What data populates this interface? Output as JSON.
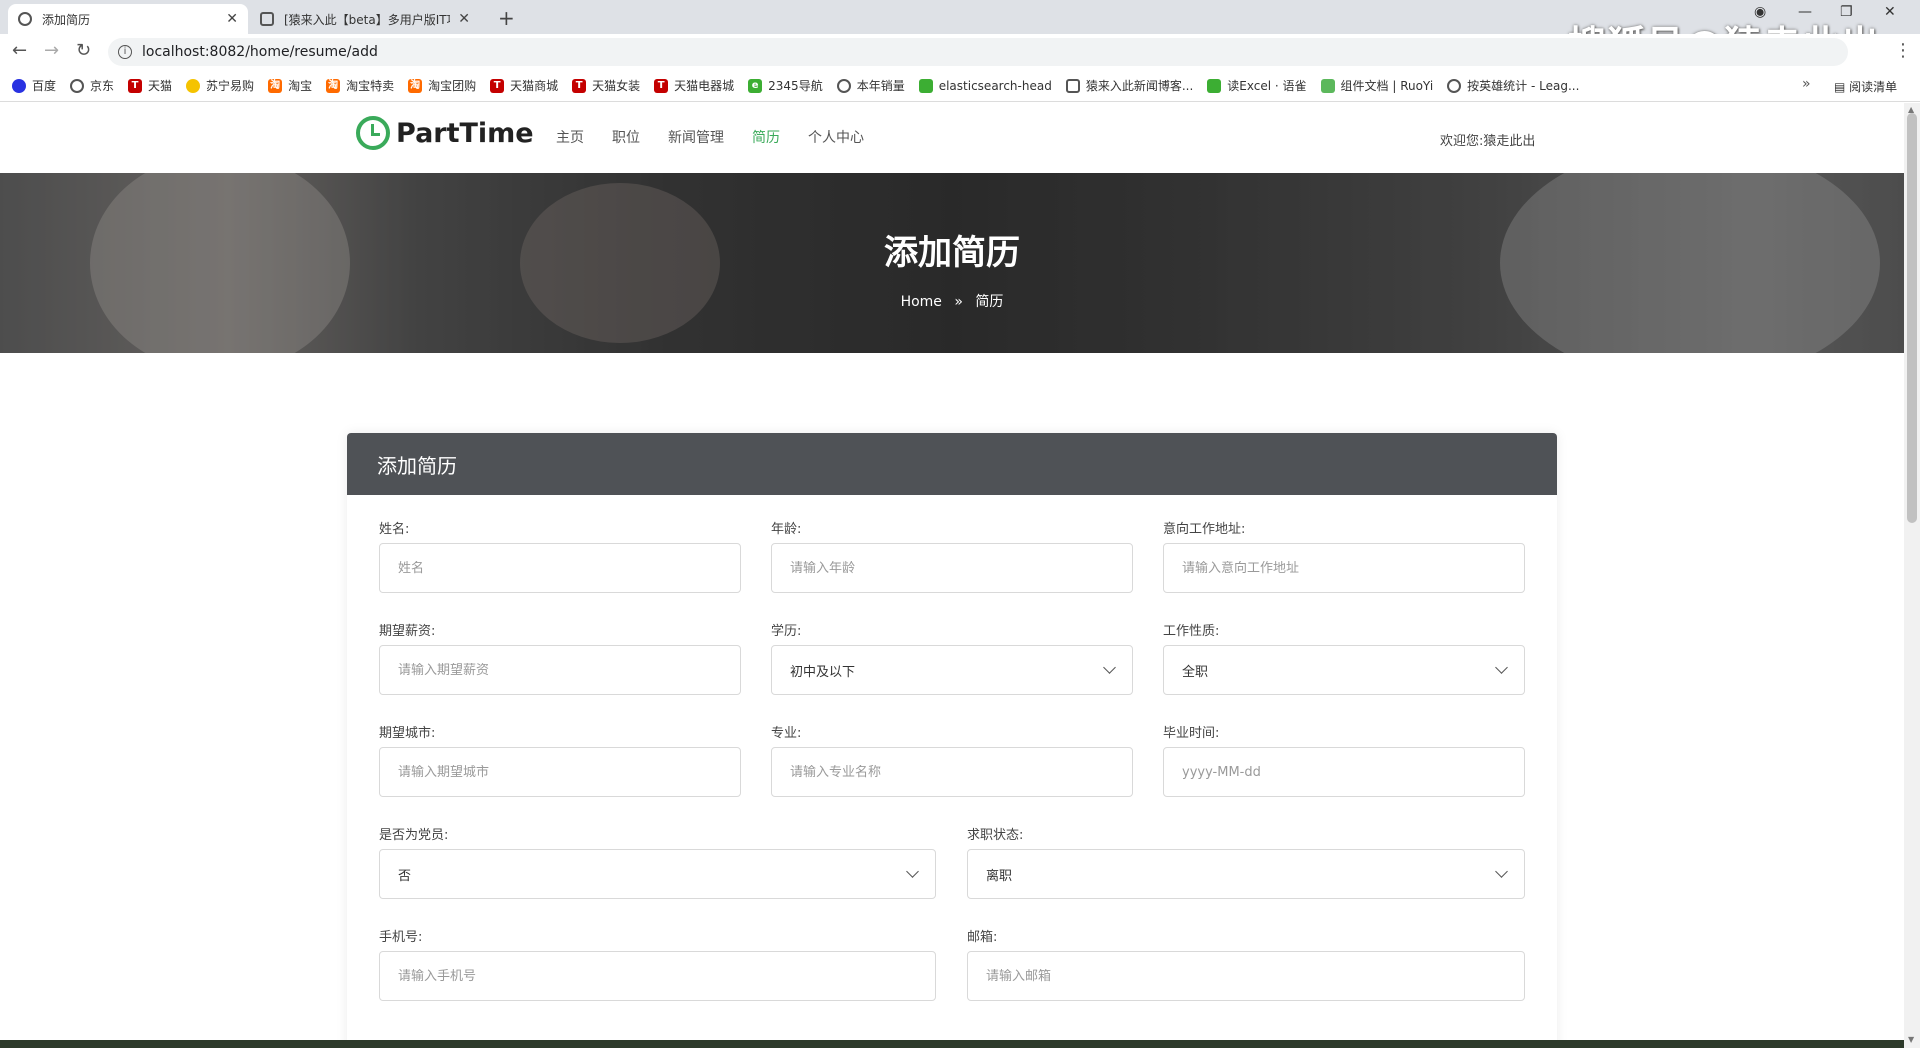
{
  "browser": {
    "tabs": [
      {
        "title": "添加简历",
        "active": true
      },
      {
        "title": "[猿来入此【beta】多用户版IT项",
        "active": false
      }
    ],
    "url": "localhost:8082/home/resume/add",
    "watermark": "搜狐号@猿走此出",
    "bookmarks": [
      {
        "label": "百度",
        "icon": "baidu-icon"
      },
      {
        "label": "京东",
        "icon": "globe-icon"
      },
      {
        "label": "天猫",
        "icon": "tmall-icon"
      },
      {
        "label": "苏宁易购",
        "icon": "suning-icon"
      },
      {
        "label": "淘宝",
        "icon": "taobao-icon"
      },
      {
        "label": "淘宝特卖",
        "icon": "taobao-icon"
      },
      {
        "label": "淘宝团购",
        "icon": "taobao-icon"
      },
      {
        "label": "天猫商城",
        "icon": "tmall-icon"
      },
      {
        "label": "天猫女装",
        "icon": "tmall-icon"
      },
      {
        "label": "天猫电器城",
        "icon": "tmall-icon"
      },
      {
        "label": "2345导航",
        "icon": "nav-icon"
      },
      {
        "label": "本年销量",
        "icon": "globe-icon"
      },
      {
        "label": "elasticsearch-head",
        "icon": "es-icon"
      },
      {
        "label": "猿来入此新闻博客...",
        "icon": "blog-icon"
      },
      {
        "label": "读Excel · 语雀",
        "icon": "yuque-icon"
      },
      {
        "label": "组件文档 | RuoYi",
        "icon": "ruoyi-icon"
      },
      {
        "label": "按英雄统计 - Leag...",
        "icon": "globe-icon"
      }
    ],
    "reading_list": "阅读清单"
  },
  "site": {
    "logo": "PartTime",
    "nav": [
      {
        "label": "主页",
        "active": false
      },
      {
        "label": "职位",
        "active": false
      },
      {
        "label": "新闻管理",
        "active": false
      },
      {
        "label": "简历",
        "active": true
      },
      {
        "label": "个人中心",
        "active": false
      }
    ],
    "welcome": "欢迎您:猿走此出",
    "accent": "#3aaa5a"
  },
  "hero": {
    "title": "添加简历",
    "breadcrumb_home": "Home",
    "breadcrumb_current": "简历"
  },
  "form": {
    "heading": "添加简历",
    "name": {
      "label": "姓名:",
      "placeholder": "姓名"
    },
    "age": {
      "label": "年龄:",
      "placeholder": "请输入年龄"
    },
    "work_address": {
      "label": "意向工作地址:",
      "placeholder": "请输入意向工作地址"
    },
    "salary": {
      "label": "期望薪资:",
      "placeholder": "请输入期望薪资"
    },
    "education": {
      "label": "学历:",
      "value": "初中及以下"
    },
    "job_type": {
      "label": "工作性质:",
      "value": "全职"
    },
    "city": {
      "label": "期望城市:",
      "placeholder": "请输入期望城市"
    },
    "major": {
      "label": "专业:",
      "placeholder": "请输入专业名称"
    },
    "graduation": {
      "label": "毕业时间:",
      "placeholder": "yyyy-MM-dd"
    },
    "party_member": {
      "label": "是否为党员:",
      "value": "否"
    },
    "job_status": {
      "label": "求职状态:",
      "value": "离职"
    },
    "phone": {
      "label": "手机号:",
      "placeholder": "请输入手机号"
    },
    "email": {
      "label": "邮箱:",
      "placeholder": "请输入邮箱"
    }
  }
}
